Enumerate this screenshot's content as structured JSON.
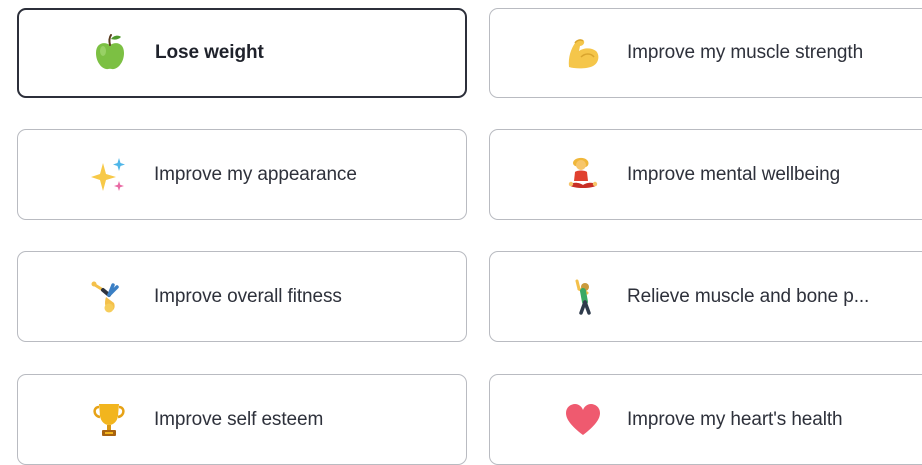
{
  "goals": {
    "lose_weight": {
      "label": "Lose weight",
      "icon": "green-apple-icon",
      "selected": true
    },
    "muscle_strength": {
      "label": "Improve my muscle strength",
      "icon": "flexed-biceps-icon",
      "selected": false
    },
    "appearance": {
      "label": "Improve my appearance",
      "icon": "sparkles-icon",
      "selected": false
    },
    "mental_wellbeing": {
      "label": "Improve mental wellbeing",
      "icon": "woman-in-lotus-position-icon",
      "selected": false
    },
    "overall_fitness": {
      "label": "Improve overall fitness",
      "icon": "person-cartwheeling-icon",
      "selected": false
    },
    "muscle_bone": {
      "label": "Relieve muscle and bone p...",
      "icon": "person-stretching-icon",
      "selected": false
    },
    "self_esteem": {
      "label": "Improve self esteem",
      "icon": "trophy-icon",
      "selected": false
    },
    "heart_health": {
      "label": "Improve my heart's health",
      "icon": "red-heart-icon",
      "selected": false
    }
  },
  "colors": {
    "selected_border": "#2c2f3a",
    "default_border": "#b9bbc1",
    "text": "#2e313b"
  }
}
